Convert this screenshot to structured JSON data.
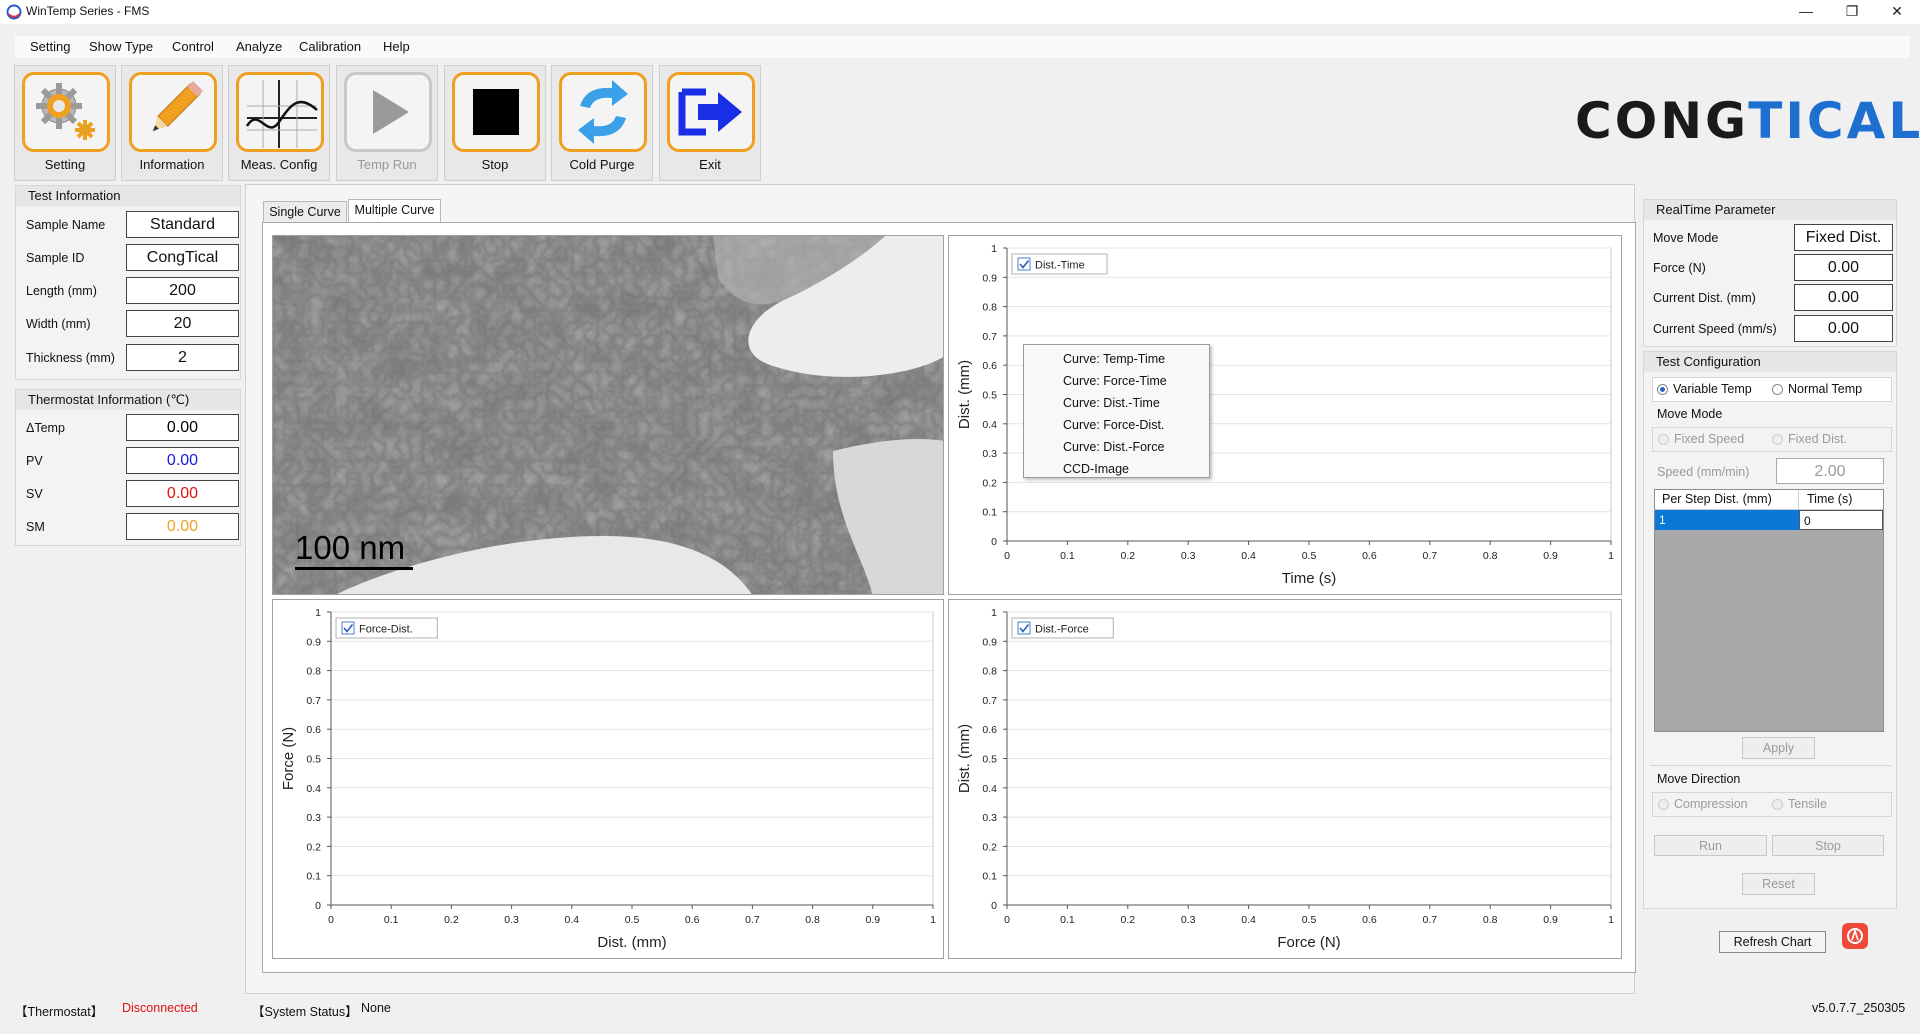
{
  "window": {
    "title": "WinTemp Series - FMS",
    "minimize_glyph": "—",
    "restore_glyph": "❐",
    "close_glyph": "✕"
  },
  "menu": [
    "Setting",
    "Show Type",
    "Control",
    "Analyze",
    "Calibration",
    "Help"
  ],
  "toolbar": {
    "setting": "Setting",
    "information": "Information",
    "meas_config": "Meas. Config",
    "temp_run": "Temp Run",
    "stop": "Stop",
    "cold_purge": "Cold Purge",
    "exit": "Exit"
  },
  "logo": {
    "part1": "CONG",
    "part2": "TICAL"
  },
  "test_info": {
    "title": "Test Information",
    "rows": [
      {
        "label": "Sample Name",
        "value": "Standard"
      },
      {
        "label": "Sample ID",
        "value": "CongTical"
      },
      {
        "label": "Length (mm)",
        "value": "200"
      },
      {
        "label": "Width (mm)",
        "value": "20"
      },
      {
        "label": "Thickness (mm)",
        "value": "2"
      }
    ]
  },
  "thermo_info": {
    "title": "Thermostat Information (℃)",
    "rows": [
      {
        "label": "ΔTemp",
        "value": "0.00",
        "color": "#000000"
      },
      {
        "label": "PV",
        "value": "0.00",
        "color": "#1a1adc"
      },
      {
        "label": "SV",
        "value": "0.00",
        "color": "#e01010"
      },
      {
        "label": "SM",
        "value": "0.00",
        "color": "#f0a020"
      }
    ]
  },
  "tabs": {
    "single": "Single Curve",
    "multiple": "Multiple Curve"
  },
  "image": {
    "scale_label": "100 nm"
  },
  "charts": {
    "ticks": [
      "0",
      "0.1",
      "0.2",
      "0.3",
      "0.4",
      "0.5",
      "0.6",
      "0.7",
      "0.8",
      "0.9",
      "1"
    ],
    "dist_time": {
      "legend": "Dist.-Time",
      "xlabel": "Time (s)",
      "ylabel": "Dist. (mm)"
    },
    "force_dist": {
      "legend": "Force-Dist.",
      "xlabel": "Dist. (mm)",
      "ylabel": "Force (N)"
    },
    "dist_force": {
      "legend": "Dist.-Force",
      "xlabel": "Force (N)",
      "ylabel": "Dist. (mm)"
    }
  },
  "context_menu": [
    "Curve: Temp-Time",
    "Curve: Force-Time",
    "Curve: Dist.-Time",
    "Curve: Force-Dist.",
    "Curve: Dist.-Force",
    "CCD-Image"
  ],
  "realtime": {
    "title": "RealTime Parameter",
    "rows": [
      {
        "label": "Move Mode",
        "value": "Fixed Dist."
      },
      {
        "label": "Force (N)",
        "value": "0.00"
      },
      {
        "label": "Current Dist. (mm)",
        "value": "0.00"
      },
      {
        "label": "Current Speed (mm/s)",
        "value": "0.00"
      }
    ]
  },
  "test_config": {
    "title": "Test Configuration",
    "variable_temp": "Variable Temp",
    "normal_temp": "Normal Temp",
    "move_mode_title": "Move Mode",
    "fixed_speed": "Fixed Speed",
    "fixed_dist": "Fixed Dist.",
    "speed_label": "Speed (mm/min)",
    "speed_value": "2.00",
    "table_headers": [
      "Per Step Dist. (mm)",
      "Time (s)"
    ],
    "table_row": [
      "1",
      "0"
    ],
    "apply": "Apply",
    "move_direction_title": "Move Direction",
    "compression": "Compression",
    "tensile": "Tensile",
    "run": "Run",
    "stop": "Stop",
    "reset": "Reset"
  },
  "refresh_chart": "Refresh Chart",
  "status": {
    "thermostat_label": "【Thermostat】",
    "thermostat_value": "Disconnected",
    "system_label": "【System Status】",
    "system_value": "None",
    "version": "v5.0.7.7_250305"
  },
  "colors": {
    "accent": "#f0a020",
    "brand_blue": "#1f6fd1",
    "error": "#e01010",
    "selection": "#0a78d7"
  }
}
